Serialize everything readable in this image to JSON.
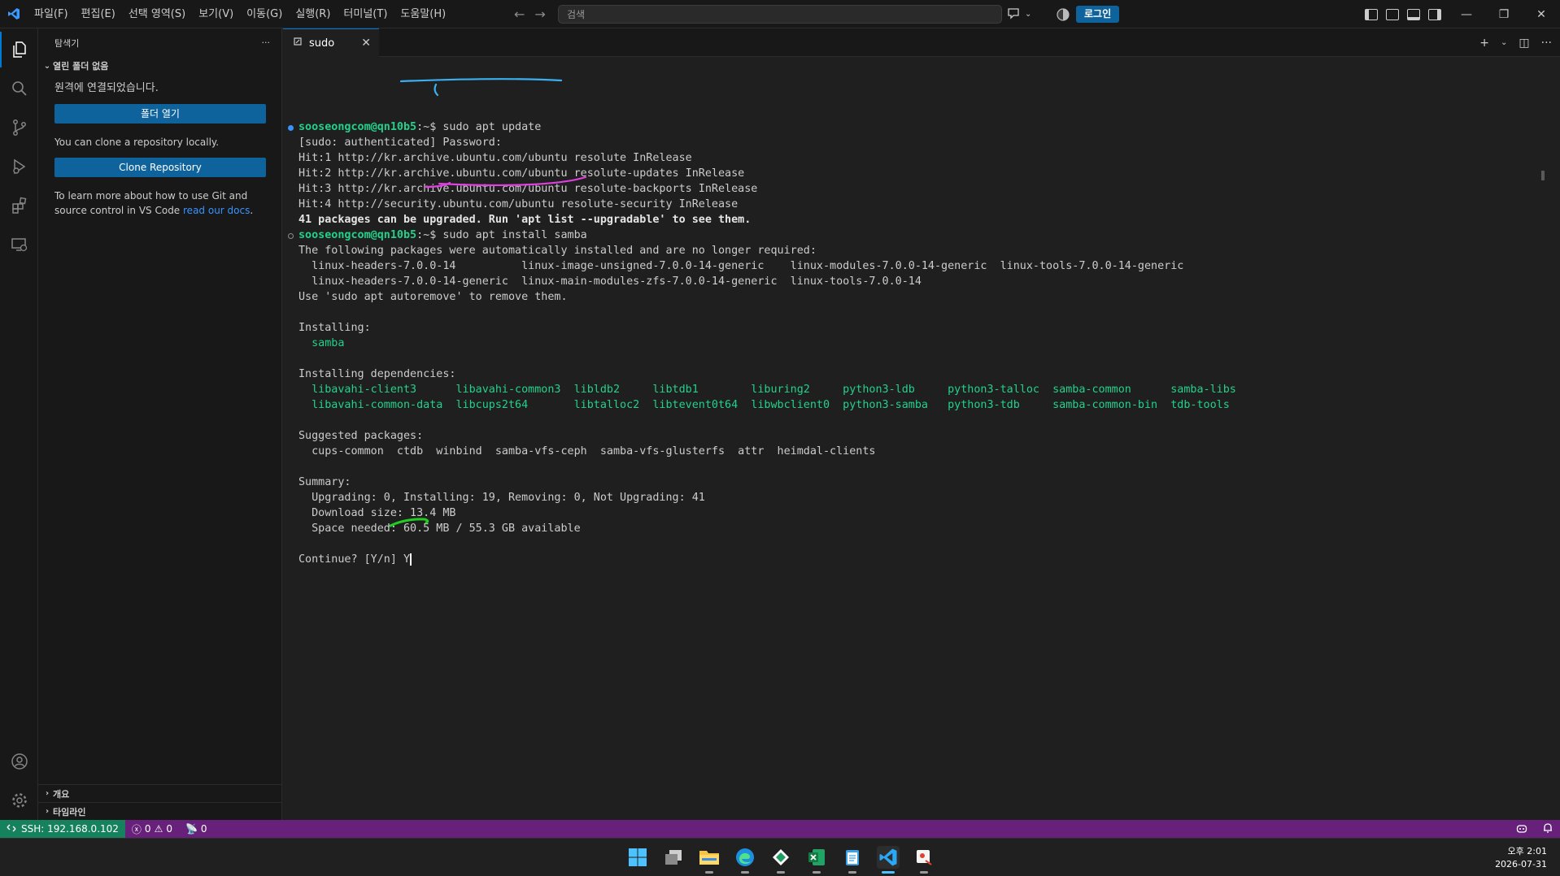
{
  "menu": [
    "파일(F)",
    "편집(E)",
    "선택 영역(S)",
    "보기(V)",
    "이동(G)",
    "실행(R)",
    "터미널(T)",
    "도움말(H)"
  ],
  "search": {
    "placeholder": "검색"
  },
  "login_label": "로그인",
  "sidebar": {
    "title": "탐색기",
    "more": "···",
    "section": "열린 폴더 없음",
    "connected": "원격에 연결되었습니다.",
    "open_folder": "폴더 열기",
    "clone_text": "You can clone a repository locally.",
    "clone_button": "Clone Repository",
    "learn_text": "To learn more about how to use Git and source control in VS Code ",
    "learn_link": "read our docs",
    "learn_end": ".",
    "outline": "개요",
    "timeline": "타임라인"
  },
  "tab": {
    "label": "sudo"
  },
  "terminal": {
    "prompt": "sooseongcom@qn10b5",
    "prompt_suffix": ":~$ ",
    "cmd1": "sudo apt update",
    "cmd2": "sudo apt install samba",
    "lines": {
      "l2": "[sudo: authenticated] Password:",
      "l3": "Hit:1 http://kr.archive.ubuntu.com/ubuntu resolute InRelease",
      "l4": "Hit:2 http://kr.archive.ubuntu.com/ubuntu resolute-updates InRelease",
      "l5": "Hit:3 http://kr.archive.ubuntu.com/ubuntu resolute-backports InRelease",
      "l6": "Hit:4 http://security.ubuntu.com/ubuntu resolute-security InRelease",
      "l7": "41 packages can be upgraded. Run 'apt list --upgradable' to see them.",
      "l9": "The following packages were automatically installed and are no longer required:",
      "l10": "  linux-headers-7.0.0-14          linux-image-unsigned-7.0.0-14-generic    linux-modules-7.0.0-14-generic  linux-tools-7.0.0-14-generic",
      "l11": "  linux-headers-7.0.0-14-generic  linux-main-modules-zfs-7.0.0-14-generic  linux-tools-7.0.0-14",
      "l12": "Use 'sudo apt autoremove' to remove them.",
      "l14": "Installing:",
      "l15": "  samba",
      "l17": "Installing dependencies:",
      "l18": "  libavahi-client3      libavahi-common3  libldb2     libtdb1        liburing2     python3-ldb     python3-talloc  samba-common      samba-libs",
      "l19": "  libavahi-common-data  libcups2t64       libtalloc2  libtevent0t64  libwbclient0  python3-samba   python3-tdb     samba-common-bin  tdb-tools",
      "l21": "Suggested packages:",
      "l22": "  cups-common  ctdb  winbind  samba-vfs-ceph  samba-vfs-glusterfs  attr  heimdal-clients",
      "l24": "Summary:",
      "l25": "  Upgrading: 0, Installing: 19, Removing: 0, Not Upgrading: 41",
      "l26": "  Download size: 13.4 MB",
      "l27": "  Space needed: 60.5 MB / 55.3 GB available",
      "l29": "Continue? [Y/n] Y"
    }
  },
  "status": {
    "remote": "SSH: 192.168.0.102",
    "errors": "0",
    "warnings": "0",
    "ports": "0"
  },
  "clock": {
    "time": "오후 2:01",
    "date": "2026-07-31"
  },
  "colors": {
    "accent": "#0078d4",
    "remote_bg": "#16825d",
    "statusbar_bg": "#68217a",
    "prompt_green": "#23d18b",
    "annotation_cyan": "#3ab0f0",
    "annotation_magenta": "#e040e0",
    "annotation_green": "#22cc22"
  }
}
